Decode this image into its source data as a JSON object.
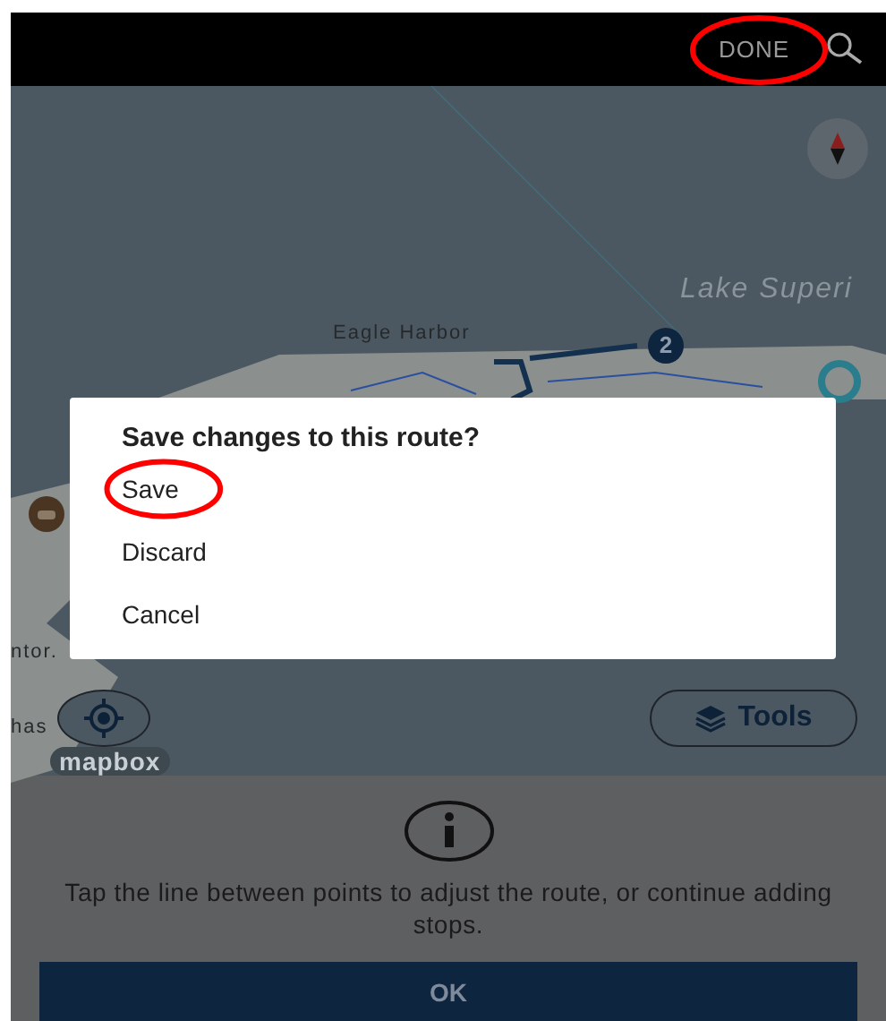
{
  "top_bar": {
    "done": {
      "label": "DONE",
      "highlighted": true
    }
  },
  "map": {
    "labels": [
      {
        "kind": "water",
        "text": "Lake Superi"
      },
      {
        "kind": "place",
        "text": "Eagle Harbor"
      },
      {
        "kind": "place",
        "text": "ntor."
      },
      {
        "kind": "place",
        "text": "has"
      }
    ],
    "stop_marker": "2",
    "logo": "mapbox",
    "tools_button": "Tools"
  },
  "dialog": {
    "title": "Save changes to this route?",
    "options": [
      {
        "label": "Save",
        "highlighted": true
      },
      {
        "label": "Discard",
        "highlighted": false
      },
      {
        "label": "Cancel",
        "highlighted": false
      }
    ]
  },
  "info_panel": {
    "message": "Tap the line between points to adjust the route, or continue adding stops.",
    "button": "OK"
  }
}
